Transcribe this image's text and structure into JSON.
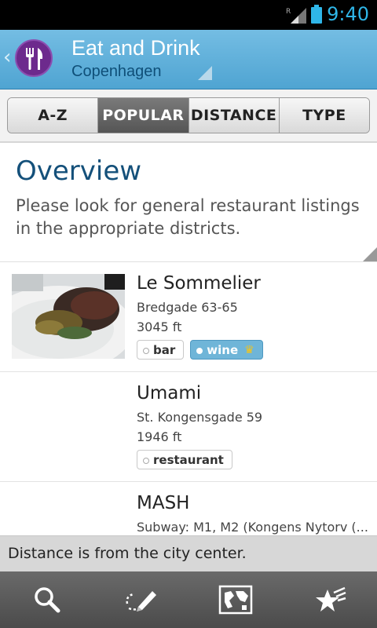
{
  "status_bar": {
    "time": "9:40",
    "roaming_indicator": "R",
    "icons": [
      "signal-icon",
      "battery-icon"
    ]
  },
  "header": {
    "title": "Eat and Drink",
    "location": "Copenhagen",
    "logo_icon": "fork-knife-icon",
    "back_icon": "chevron-left-icon",
    "accent_color": "#4fa4d2",
    "logo_color": "#6d2a8d"
  },
  "tabs": [
    {
      "label": "A-Z",
      "active": false
    },
    {
      "label": "POPULAR",
      "active": true
    },
    {
      "label": "DISTANCE",
      "active": false
    },
    {
      "label": "TYPE",
      "active": false
    }
  ],
  "overview": {
    "title": "Overview",
    "text": "Please look for general restaurant listings in the appropriate districts."
  },
  "listings": [
    {
      "name": "Le Sommelier",
      "address": "Bredgade 63-65",
      "distance": "3045 ft",
      "tags": [
        {
          "label": "bar"
        },
        {
          "label": "wine",
          "highlight": true,
          "icon": "crown-icon"
        }
      ],
      "has_photo": true
    },
    {
      "name": "Umami",
      "address": "St. Kongensgade 59",
      "distance": "1946 ft",
      "tags": [
        {
          "label": "restaurant"
        }
      ]
    },
    {
      "name": "MASH",
      "address": "Subway: M1, M2 (Kongens Nytorv (...",
      "distance": ""
    }
  ],
  "footer_note": "Distance is from the city center.",
  "bottom_bar": [
    "search-icon",
    "edit-notes-icon",
    "map-icon",
    "favorites-icon"
  ]
}
